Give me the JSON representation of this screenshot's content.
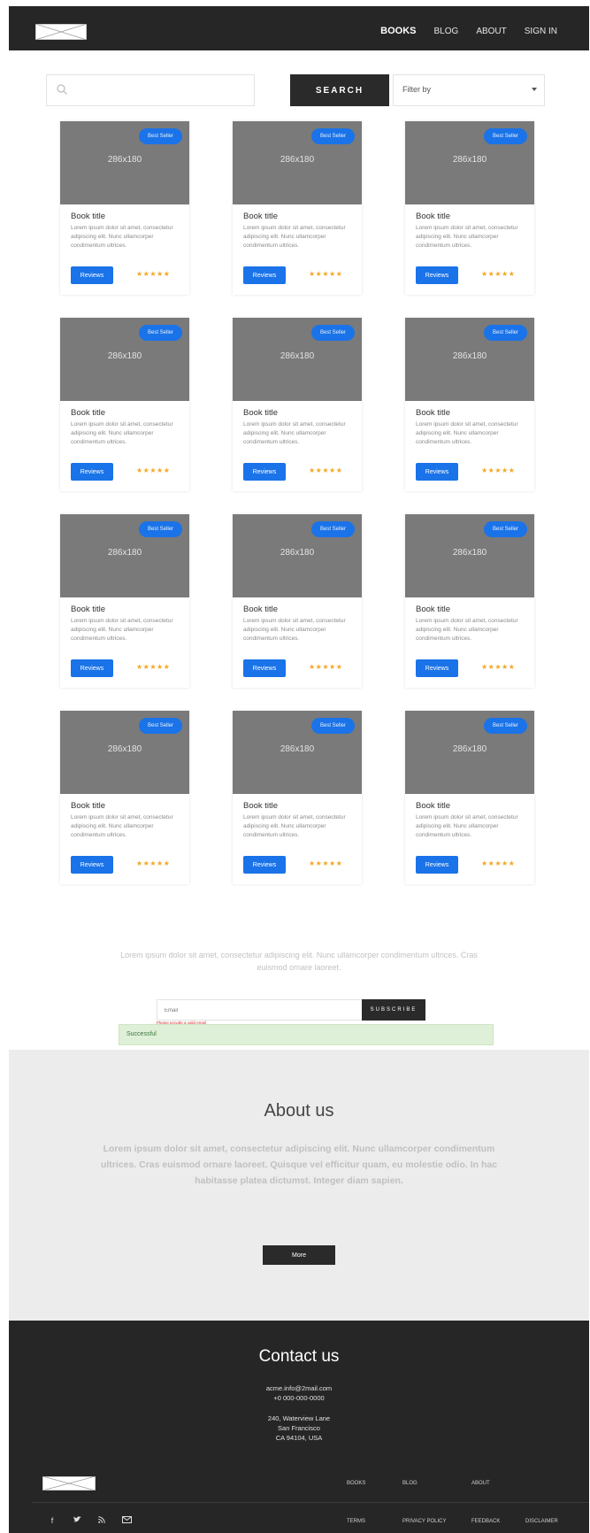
{
  "header": {
    "nav": [
      {
        "label": "BOOKS",
        "active": true
      },
      {
        "label": "BLOG",
        "active": false
      },
      {
        "label": "ABOUT",
        "active": false
      },
      {
        "label": "SIGN IN",
        "active": false
      }
    ]
  },
  "search": {
    "placeholder": "",
    "button_label": "SEARCH"
  },
  "filter": {
    "selected": "Filter by"
  },
  "books": [
    {
      "badge": "Best Seller",
      "image": "286x180",
      "title": "Book title",
      "description": "Lorem ipsum dolor sit amet, consectetur adipiscing elit. Nunc ullamcorper condimentum ultrices.",
      "button": "Reviews",
      "stars": "★★★★★",
      "rating": 5
    },
    {
      "badge": "Best Seller",
      "image": "286x180",
      "title": "Book title",
      "description": "Lorem ipsum dolor sit amet, consectetur adipiscing elit. Nunc ullamcorper condimentum ultrices.",
      "button": "Reviews",
      "stars": "★★★★★",
      "rating": 5
    },
    {
      "badge": "Best Seller",
      "image": "286x180",
      "title": "Book title",
      "description": "Lorem ipsum dolor sit amet, consectetur adipiscing elit. Nunc ullamcorper condimentum ultrices.",
      "button": "Reviews",
      "stars": "★★★★★",
      "rating": 5
    },
    {
      "badge": "Best Seller",
      "image": "286x180",
      "title": "Book title",
      "description": "Lorem ipsum dolor sit amet, consectetur adipiscing elit. Nunc ullamcorper condimentum ultrices.",
      "button": "Reviews",
      "stars": "★★★★★",
      "rating": 5
    },
    {
      "badge": "Best Seller",
      "image": "286x180",
      "title": "Book title",
      "description": "Lorem ipsum dolor sit amet, consectetur adipiscing elit. Nunc ullamcorper condimentum ultrices.",
      "button": "Reviews",
      "stars": "★★★★★",
      "rating": 5
    },
    {
      "badge": "Best Seller",
      "image": "286x180",
      "title": "Book title",
      "description": "Lorem ipsum dolor sit amet, consectetur adipiscing elit. Nunc ullamcorper condimentum ultrices.",
      "button": "Reviews",
      "stars": "★★★★★",
      "rating": 5
    },
    {
      "badge": "Best Seller",
      "image": "286x180",
      "title": "Book title",
      "description": "Lorem ipsum dolor sit amet, consectetur adipiscing elit. Nunc ullamcorper condimentum ultrices.",
      "button": "Reviews",
      "stars": "★★★★★",
      "rating": 5
    },
    {
      "badge": "Best Seller",
      "image": "286x180",
      "title": "Book title",
      "description": "Lorem ipsum dolor sit amet, consectetur adipiscing elit. Nunc ullamcorper condimentum ultrices.",
      "button": "Reviews",
      "stars": "★★★★★",
      "rating": 5
    },
    {
      "badge": "Best Seller",
      "image": "286x180",
      "title": "Book title",
      "description": "Lorem ipsum dolor sit amet, consectetur adipiscing elit. Nunc ullamcorper condimentum ultrices.",
      "button": "Reviews",
      "stars": "★★★★★",
      "rating": 5
    },
    {
      "badge": "Best Seller",
      "image": "286x180",
      "title": "Book title",
      "description": "Lorem ipsum dolor sit amet, consectetur adipiscing elit. Nunc ullamcorper condimentum ultrices.",
      "button": "Reviews",
      "stars": "★★★★★",
      "rating": 5
    },
    {
      "badge": "Best Seller",
      "image": "286x180",
      "title": "Book title",
      "description": "Lorem ipsum dolor sit amet, consectetur adipiscing elit. Nunc ullamcorper condimentum ultrices.",
      "button": "Reviews",
      "stars": "★★★★★",
      "rating": 5
    },
    {
      "badge": "Best Seller",
      "image": "286x180",
      "title": "Book title",
      "description": "Lorem ipsum dolor sit amet, consectetur adipiscing elit. Nunc ullamcorper condimentum ultrices.",
      "button": "Reviews",
      "stars": "★★★★★",
      "rating": 5
    }
  ],
  "newsletter": {
    "text": "Lorem ipsum dolor sit amet, consectetur adipiscing elit. Nunc ullamcorper condimentum ultrices. Cras euismod ornare laoreet.",
    "email_placeholder": "Email",
    "subscribe_label": "SUBSCRIBE",
    "error": "Please provide a valid email",
    "success": "Successful"
  },
  "about": {
    "title": "About us",
    "text": "Lorem ipsum dolor sit amet, consectetur adipiscing elit. Nunc ullamcorper condimentum ultrices. Cras euismod ornare laoreet. Quisque vel efficitur quam, eu molestie odio. In hac habitasse platea dictumst. Integer diam sapien.",
    "button": "More"
  },
  "contact": {
    "title": "Contact us",
    "email": "acme.info@2mail.com",
    "phone": "+0 000-000-0000",
    "address1": "240, Waterview Lane",
    "address2": "San Francisco",
    "address3": "CA 94104, USA"
  },
  "footer": {
    "nav": [
      "BOOKS",
      "BLOG",
      "ABOUT"
    ],
    "social": [
      "facebook-icon",
      "twitter-icon",
      "rss-icon",
      "mail-icon"
    ],
    "legal": [
      "TERMS",
      "PRIVACY POLICY",
      "FEEDBACK",
      "DISCLAIMER"
    ]
  },
  "colors": {
    "header_bg": "#262626",
    "accent": "#1a73e8",
    "star": "#f5a623",
    "success_bg": "#dff0d8",
    "about_bg": "#ececec"
  }
}
